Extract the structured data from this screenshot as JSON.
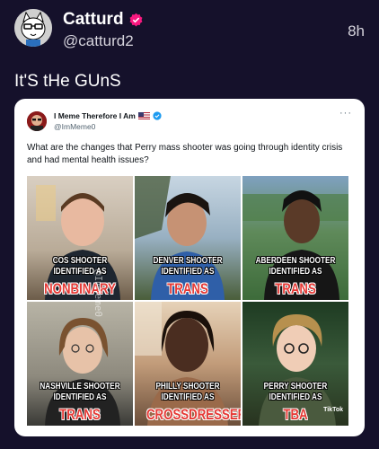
{
  "tweet": {
    "display_name": "Catturd",
    "handle": "@catturd2",
    "time": "8h",
    "text": "It'S tHe GUnS"
  },
  "quoted": {
    "display_name": "I Meme Therefore I Am",
    "handle": "@ImMeme0",
    "more": "···",
    "text": "What are the changes that Perry mass shooter was going through identity crisis and had mental health issues?",
    "image": {
      "watermark": "@ImMeme0",
      "tiktok_label": "TikTok",
      "panels": [
        {
          "line1": "COS SHOOTER",
          "line2": "IDENTIFIED AS",
          "label": "NONBINARY"
        },
        {
          "line1": "DENVER SHOOTER",
          "line2": "IDENTIFIED AS",
          "label": "TRANS"
        },
        {
          "line1": "ABERDEEN SHOOTER",
          "line2": "IDENTIFIED AS",
          "label": "TRANS"
        },
        {
          "line1": "NASHVILLE SHOOTER",
          "line2": "IDENTIFIED AS",
          "label": "TRANS"
        },
        {
          "line1": "PHILLY SHOOTER",
          "line2": "IDENTIFIED AS",
          "label": "CROSSDRESSER"
        },
        {
          "line1": "PERRY SHOOTER",
          "line2": "IDENTIFIED AS",
          "label": "TBA"
        }
      ]
    }
  },
  "colors": {
    "background": "#15112b",
    "verified": "#f91880",
    "quote_verified": "#1d9bf0",
    "caption_accent": "#e53935"
  }
}
